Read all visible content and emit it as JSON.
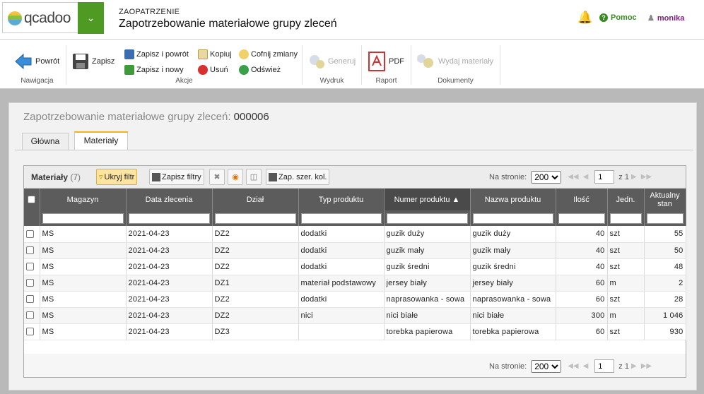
{
  "app": {
    "logo": "qcadoo",
    "section": "ZAOPATRZENIE",
    "title": "Zapotrzebowanie materiałowe grupy zleceń"
  },
  "header": {
    "help_label": "Pomoc",
    "user_name": "monika"
  },
  "ribbon": {
    "back_label": "Powrót",
    "save_label": "Zapisz",
    "save_back_label": "Zapisz i powrót",
    "save_new_label": "Zapisz i nowy",
    "copy_label": "Kopiuj",
    "delete_label": "Usuń",
    "undo_label": "Cofnij zmiany",
    "refresh_label": "Odśwież",
    "generate_label": "Generuj",
    "pdf_label": "PDF",
    "issue_label": "Wydaj materiały",
    "groups": {
      "nav": "Nawigacja",
      "actions": "Akcje",
      "print": "Wydruk",
      "report": "Raport",
      "documents": "Dokumenty"
    }
  },
  "form": {
    "label": "Zapotrzebowanie materiałowe grupy zleceń:",
    "number": "000006"
  },
  "tabs": [
    {
      "label": "Główna"
    },
    {
      "label": "Materiały"
    }
  ],
  "grid": {
    "title": "Materiały",
    "count": "(7)",
    "toolbar": {
      "hide_filter": "Ukryj filtr",
      "save_filters": "Zapisz filtry",
      "save_widths": "Zap. szer. kol."
    },
    "pager": {
      "label": "Na stronie:",
      "per_page": "200",
      "page": "1",
      "of_label": "z 1"
    },
    "columns": [
      "Magazyn",
      "Data zlecenia",
      "Dział",
      "Typ produktu",
      "Numer produktu",
      "Nazwa produktu",
      "Ilość",
      "Jedn.",
      "Aktualny stan"
    ],
    "rows": [
      [
        "MS",
        "2021-04-23",
        "DZ2",
        "dodatki",
        "guzik duży",
        "guzik duży",
        "40",
        "szt",
        "55"
      ],
      [
        "MS",
        "2021-04-23",
        "DZ2",
        "dodatki",
        "guzik mały",
        "guzik mały",
        "40",
        "szt",
        "50"
      ],
      [
        "MS",
        "2021-04-23",
        "DZ2",
        "dodatki",
        "guzik średni",
        "guzik średni",
        "40",
        "szt",
        "48"
      ],
      [
        "MS",
        "2021-04-23",
        "DZ1",
        "materiał podstawowy",
        "jersey biały",
        "jersey biały",
        "60",
        "m",
        "2"
      ],
      [
        "MS",
        "2021-04-23",
        "DZ2",
        "dodatki",
        "naprasowanka - sowa",
        "naprasowanka - sowa",
        "60",
        "szt",
        "28"
      ],
      [
        "MS",
        "2021-04-23",
        "DZ2",
        "nici",
        "nici białe",
        "nici białe",
        "300",
        "m",
        "1 046"
      ],
      [
        "MS",
        "2021-04-23",
        "DZ3",
        "",
        "torebka papierowa",
        "torebka papierowa",
        "60",
        "szt",
        "930"
      ]
    ]
  },
  "colors": {
    "accent_green": "#4e9a23",
    "tab_accent": "#f3b21b",
    "header_dark": "#5c5c5c"
  }
}
